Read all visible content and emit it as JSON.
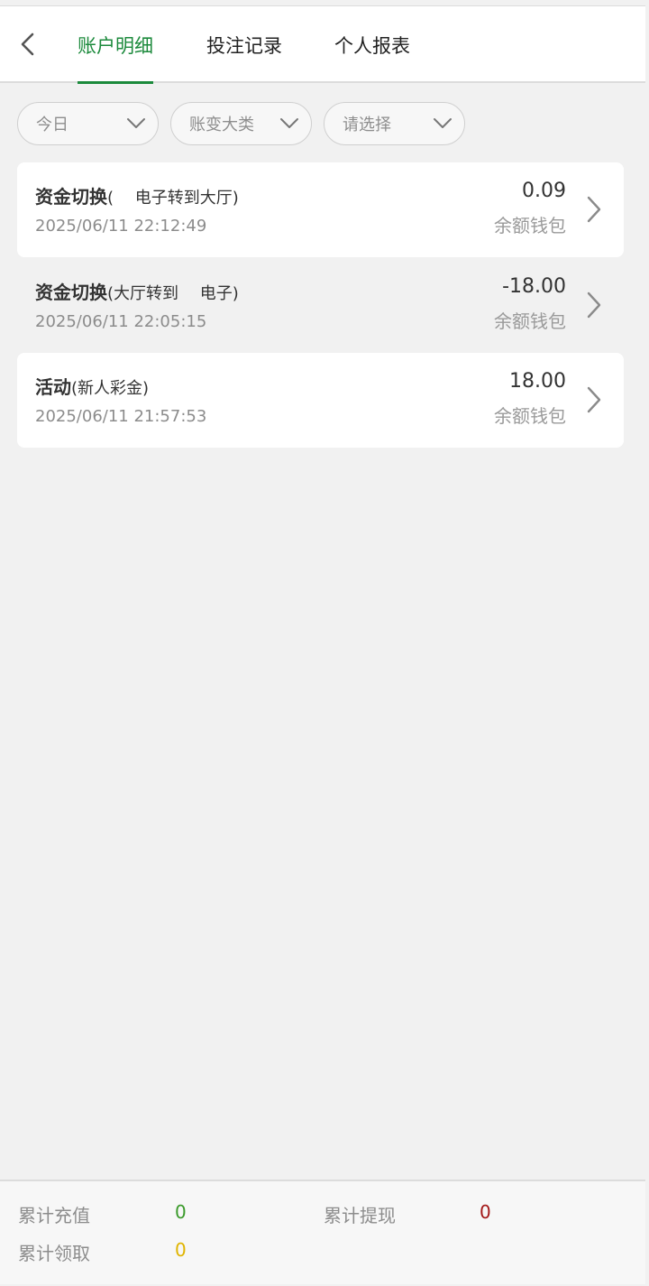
{
  "header": {
    "back_icon": "chevron-left-icon",
    "tabs": [
      {
        "label": "账户明细",
        "active": true
      },
      {
        "label": "投注记录",
        "active": false
      },
      {
        "label": "个人报表",
        "active": false
      }
    ],
    "accent_color": "#1c8a3c"
  },
  "filters": [
    {
      "value": "今日",
      "icon": "chevron-down-icon"
    },
    {
      "value": "账变大类",
      "icon": "chevron-down-icon"
    },
    {
      "value": "请选择",
      "icon": "chevron-down-icon"
    }
  ],
  "records": [
    {
      "title": "资金切换",
      "detail": "(　 电子转到大厅)",
      "time": "2025/06/11 22:12:49",
      "amount": "0.09",
      "wallet": "余额钱包"
    },
    {
      "title": "资金切换",
      "detail": "(大厅转到　 电子)",
      "time": "2025/06/11 22:05:15",
      "amount": "-18.00",
      "wallet": "余额钱包"
    },
    {
      "title": "活动",
      "detail": "(新人彩金)",
      "time": "2025/06/11 21:57:53",
      "amount": "18.00",
      "wallet": "余额钱包"
    }
  ],
  "footer": {
    "stats": [
      {
        "label": "累计充值",
        "value": "0",
        "color": "#3a9a2a"
      },
      {
        "label": "累计提现",
        "value": "0",
        "color": "#a31818"
      },
      {
        "label": "累计领取",
        "value": "0",
        "color": "#e0b400"
      }
    ]
  }
}
